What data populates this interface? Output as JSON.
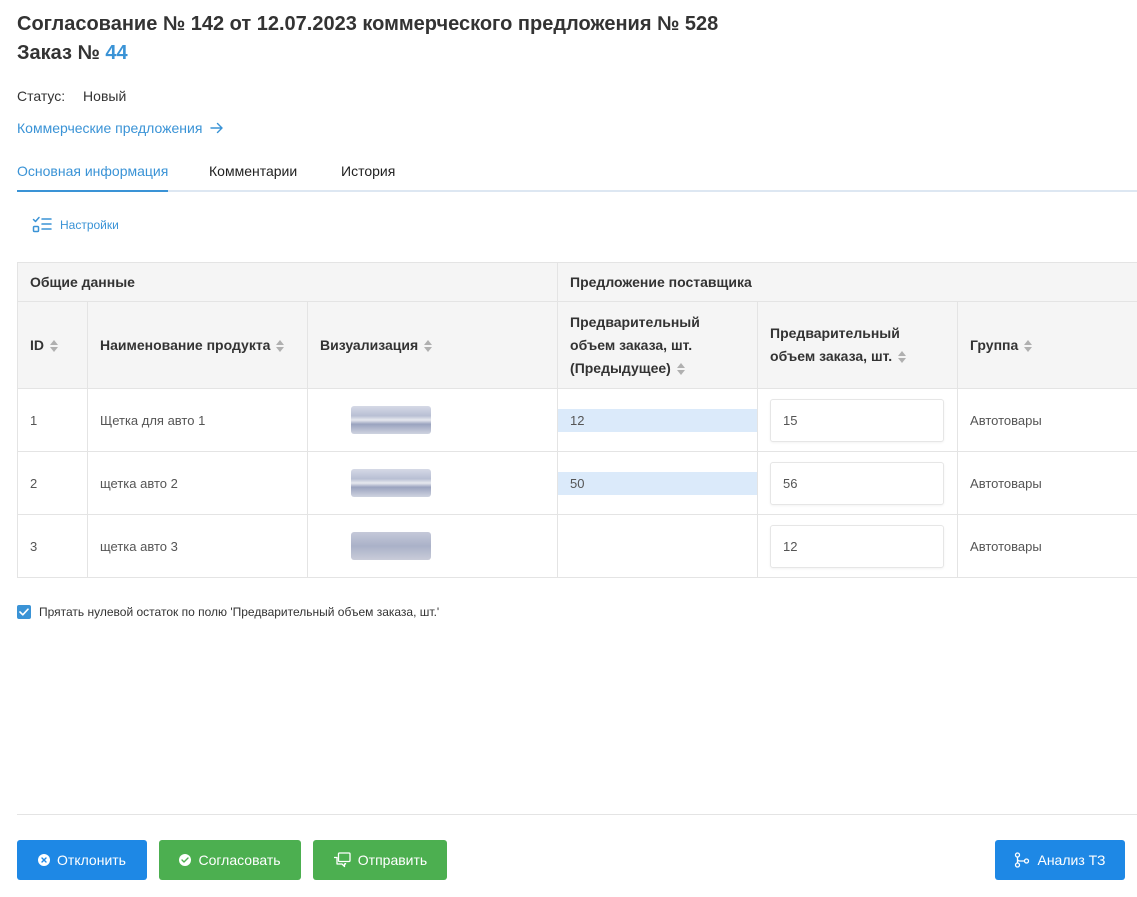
{
  "header": {
    "title_line1": "Согласование № 142 от 12.07.2023 коммерческого предложения № 528",
    "order_label": "Заказ №",
    "order_number": "44"
  },
  "status": {
    "label": "Статус:",
    "value": "Новый"
  },
  "link_kp": {
    "label": "Коммерческие предложения"
  },
  "tabs": [
    {
      "label": "Основная информация",
      "active": true
    },
    {
      "label": "Комментарии",
      "active": false
    },
    {
      "label": "История",
      "active": false
    }
  ],
  "settings": {
    "label": "Настройки"
  },
  "table": {
    "groups": {
      "general": "Общие данные",
      "supplier": "Предложение поставщика"
    },
    "columns": {
      "id": "ID",
      "name": "Наименование продукта",
      "visual": "Визуализация",
      "prev_qty": "Предварительный объем заказа, шт. (Предыдущее)",
      "qty": "Предварительный объем заказа, шт.",
      "group": "Группа"
    },
    "rows": [
      {
        "id": "1",
        "name": "Щетка для авто 1",
        "prev_qty": "12",
        "qty": "15",
        "group": "Автотовары"
      },
      {
        "id": "2",
        "name": "щетка авто 2",
        "prev_qty": "50",
        "qty": "56",
        "group": "Автотовары"
      },
      {
        "id": "3",
        "name": "щетка авто 3",
        "prev_qty": "",
        "qty": "12",
        "group": "Автотовары"
      }
    ]
  },
  "hide_zero": {
    "label": "Прятать нулевой остаток по полю 'Предварительный объем заказа, шт.'",
    "checked": true
  },
  "buttons": {
    "reject": "Отклонить",
    "approve": "Согласовать",
    "send": "Отправить",
    "analysis": "Анализ ТЗ"
  },
  "colors": {
    "accent": "#3a93d6",
    "primary_button": "#1e88e5",
    "success_button": "#4caf50",
    "prev_value_highlight": "#dbeafa"
  }
}
